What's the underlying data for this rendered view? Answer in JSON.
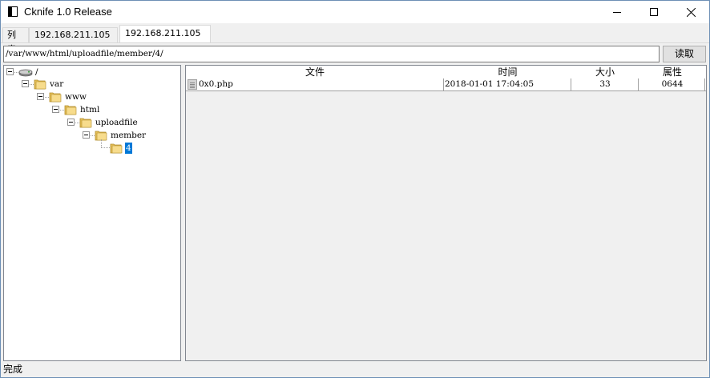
{
  "window": {
    "title": "Cknife 1.0 Release",
    "icon": "app-window-icon"
  },
  "tabs": [
    {
      "label": "列表"
    },
    {
      "label": "192.168.211.105"
    },
    {
      "label": "192.168.211.105",
      "active": true
    }
  ],
  "path_bar": {
    "value": "/var/www/html/uploadfile/member/4/",
    "read_label": "读取"
  },
  "tree": {
    "nodes": [
      {
        "label": "/",
        "icon": "drive-icon"
      },
      {
        "label": "var",
        "icon": "folder-icon"
      },
      {
        "label": "www",
        "icon": "folder-icon"
      },
      {
        "label": "html",
        "icon": "folder-icon"
      },
      {
        "label": "uploadfile",
        "icon": "folder-icon"
      },
      {
        "label": "member",
        "icon": "folder-icon"
      },
      {
        "label": "4",
        "icon": "folder-icon",
        "selected": true
      }
    ]
  },
  "files": {
    "columns": [
      "文件",
      "时间",
      "大小",
      "属性"
    ],
    "rows": [
      {
        "name": "0x0.php",
        "time": "2018-01-01 17:04:05",
        "size": "33",
        "perm": "0644"
      }
    ]
  },
  "status": {
    "text": "完成"
  },
  "colors": {
    "selection": "#0078d7",
    "folder": "#e8c35c",
    "window_bg": "#f0f0f0"
  }
}
